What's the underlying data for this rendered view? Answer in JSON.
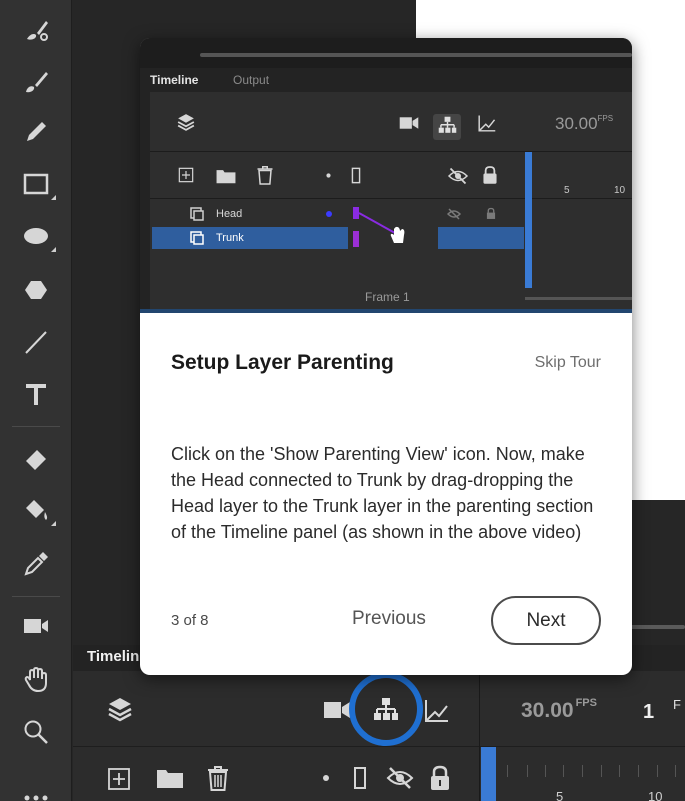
{
  "stage": {
    "background": "#262626",
    "paper": "#ffffff"
  },
  "tools": [
    {
      "name": "subselect-tool",
      "icon": "subselect-brush-icon"
    },
    {
      "name": "paint-brush-tool",
      "icon": "paint-brush-icon"
    },
    {
      "name": "pencil-tool",
      "icon": "pencil-icon"
    },
    {
      "name": "rectangle-tool",
      "icon": "rectangle-icon"
    },
    {
      "name": "oval-tool",
      "icon": "oval-icon"
    },
    {
      "name": "polystar-tool",
      "icon": "polygon-icon"
    },
    {
      "name": "line-tool",
      "icon": "line-icon"
    },
    {
      "name": "text-tool",
      "icon": "text-icon",
      "glyph": "T"
    },
    {
      "name": "eraser-tool",
      "icon": "eraser-icon"
    },
    {
      "name": "paint-bucket-tool",
      "icon": "paint-bucket-icon"
    },
    {
      "name": "eyedropper-tool",
      "icon": "eyedropper-icon"
    },
    {
      "name": "camera-tool",
      "icon": "camera-icon"
    },
    {
      "name": "hand-tool",
      "icon": "hand-icon"
    },
    {
      "name": "zoom-tool",
      "icon": "magnifier-icon"
    },
    {
      "name": "more-tools",
      "icon": "more-icon"
    }
  ],
  "timeline": {
    "tab_label": "Timelin",
    "fps_value": "30.00",
    "fps_unit": "FPS",
    "current_frame": "1",
    "frame_suffix": "F",
    "ruler_labels": [
      "5",
      "10"
    ],
    "accent": "#3a7bd5",
    "highlight_ring": "#1f6fd1"
  },
  "tour": {
    "video": {
      "tabs": [
        "Timeline",
        "Output"
      ],
      "fps_value": "30.00",
      "fps_unit": "FPS",
      "layers": [
        "Head",
        "Trunk"
      ],
      "ruler_labels": [
        "5",
        "10"
      ],
      "frame_label": "Frame 1"
    },
    "title": "Setup Layer Parenting",
    "skip_label": "Skip Tour",
    "body": "Click on the 'Show Parenting View' icon. Now, make the Head connected to Trunk by drag-dropping the Head layer to the Trunk layer in the parenting section of the Timeline panel (as shown in the above video)",
    "step_counter": "3 of 8",
    "previous_label": "Previous",
    "next_label": "Next"
  }
}
